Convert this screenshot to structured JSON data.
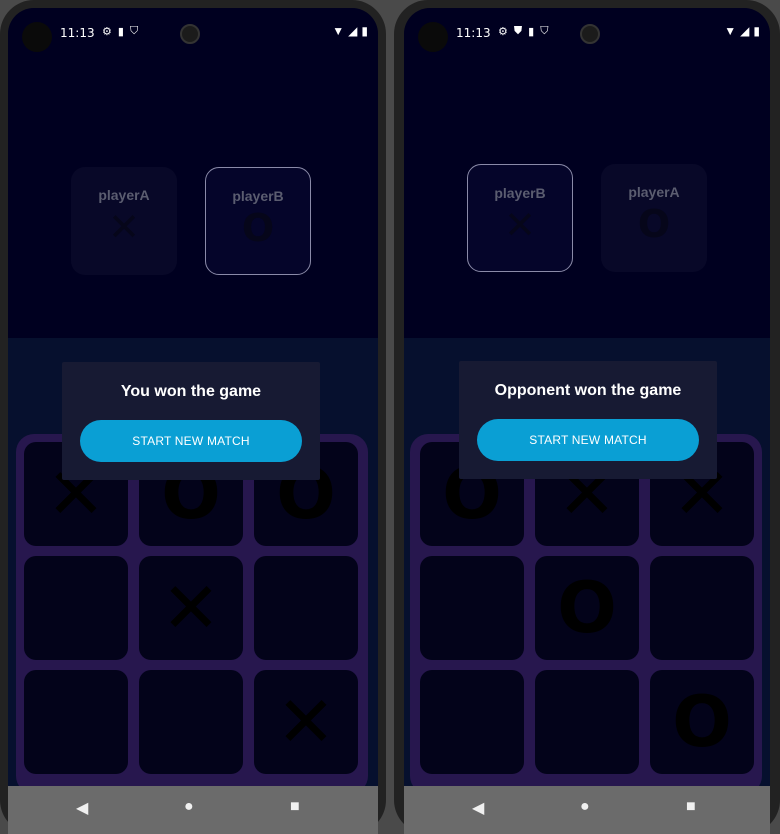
{
  "left": {
    "time": "11:13",
    "status_icons": [
      "gear-icon",
      "sim-card-icon",
      "shield-icon"
    ],
    "players": [
      {
        "name": "playerA",
        "mark": "✕",
        "active": false
      },
      {
        "name": "playerB",
        "mark": "O",
        "active": true
      }
    ],
    "board": [
      "✕",
      "O",
      "O",
      "",
      "✕",
      "",
      "",
      "",
      "✕"
    ],
    "dialog": {
      "message": "You won the game",
      "button": "START NEW MATCH"
    }
  },
  "right": {
    "time": "11:13",
    "status_icons": [
      "gear-icon",
      "shield-icon",
      "sim-card-icon",
      "shield-icon"
    ],
    "players": [
      {
        "name": "playerB",
        "mark": "✕",
        "active": true
      },
      {
        "name": "playerA",
        "mark": "O",
        "active": false
      }
    ],
    "board": [
      "O",
      "✕",
      "✕",
      "",
      "O",
      "",
      "",
      "",
      "O"
    ],
    "dialog": {
      "message": "Opponent won the game",
      "button": "START NEW MATCH"
    }
  },
  "colors": {
    "background": "#01012a",
    "board": "#27174e",
    "cell": "#03031a",
    "dialog": "#171a33",
    "button": "#0a9fd4",
    "navbar": "#6b6b6b"
  },
  "nav_icons": [
    "back-icon",
    "home-icon",
    "recents-icon"
  ]
}
